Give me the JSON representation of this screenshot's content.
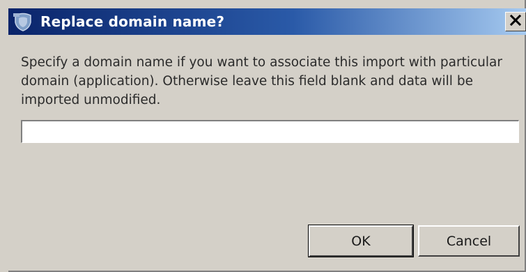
{
  "dialog": {
    "title": "Replace domain name?",
    "close_label": "✕",
    "description": "Specify a domain name if you want to associate this import with particular domain (application). Otherwise leave this field blank and data will be imported unmodified.",
    "domain_input": {
      "value": "",
      "placeholder": ""
    },
    "buttons": {
      "ok_label": "OK",
      "cancel_label": "Cancel"
    },
    "icons": {
      "title_icon": "app-shield-icon",
      "close_icon": "close-icon"
    }
  }
}
